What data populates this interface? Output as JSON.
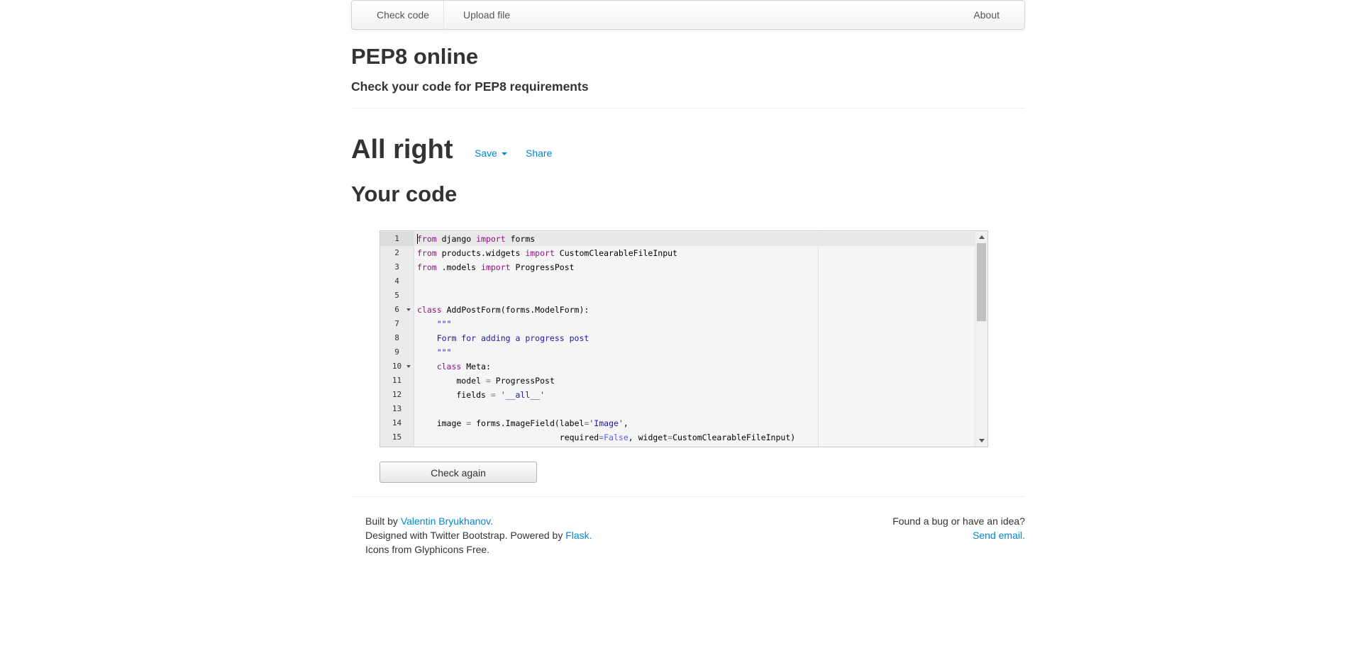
{
  "navbar": {
    "check_code": "Check code",
    "upload_file": "Upload file",
    "about": "About"
  },
  "header": {
    "title": "PEP8 online",
    "subtitle": "Check your code for PEP8 requirements"
  },
  "result": {
    "status": "All right",
    "save_label": "Save",
    "share_label": "Share"
  },
  "code_section": {
    "heading": "Your code",
    "lines": [
      "from django import forms",
      "from products.widgets import CustomClearableFileInput",
      "from .models import ProgressPost",
      "",
      "",
      "class AddPostForm(forms.ModelForm):",
      "    \"\"\"",
      "    Form for adding a progress post",
      "    \"\"\"",
      "    class Meta:",
      "        model = ProgressPost",
      "        fields = '__all__'",
      "",
      "    image = forms.ImageField(label='Image',",
      "                             required=False, widget=CustomClearableFileInput)"
    ],
    "fold_lines": [
      6,
      10
    ],
    "active_line": 1,
    "check_again_label": "Check again"
  },
  "footer": {
    "built_by_prefix": "Built by ",
    "author_link": "Valentin Bryukhanov.",
    "designed_prefix": "Designed with Twitter Bootstrap. Powered by ",
    "flask_link": "Flask.",
    "icons_text": "Icons from Glyphicons Free.",
    "bug_text": "Found a bug or have an idea?",
    "email_link": "Send email."
  },
  "colors": {
    "link": "#0088cc",
    "keyword": "#930f80",
    "string": "#1a1aa6",
    "constant": "#585cf6"
  }
}
